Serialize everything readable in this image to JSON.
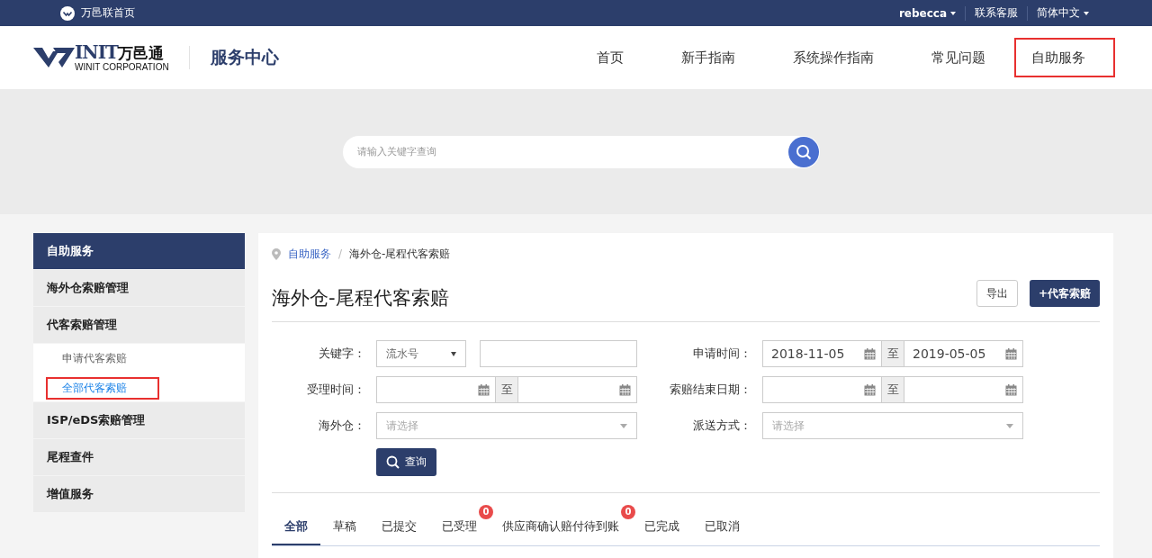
{
  "topbar": {
    "home_link": "万邑联首页",
    "user": "rebecca",
    "support": "联系客服",
    "language": "简体中文"
  },
  "header": {
    "logo_letters": "INIT",
    "logo_name": "万邑通",
    "logo_sub": "WINIT CORPORATION",
    "site_title": "服务中心",
    "nav": [
      {
        "label": "首页",
        "selected": false
      },
      {
        "label": "新手指南",
        "selected": false
      },
      {
        "label": "系统操作指南",
        "selected": false
      },
      {
        "label": "常见问题",
        "selected": false
      },
      {
        "label": "自助服务",
        "selected": true
      }
    ]
  },
  "search": {
    "placeholder": "请输入关键字查询"
  },
  "sidebar": {
    "title": "自助服务",
    "groups": [
      {
        "label": "海外仓索赔管理"
      },
      {
        "label": "代客索赔管理",
        "children": [
          {
            "label": "申请代客索赔",
            "selected": false
          },
          {
            "label": "全部代客索赔",
            "selected": true
          }
        ]
      },
      {
        "label": "ISP/eDS索赔管理"
      },
      {
        "label": "尾程查件"
      },
      {
        "label": "增值服务"
      }
    ]
  },
  "breadcrumb": {
    "separator": "/",
    "items": [
      "自助服务",
      "海外仓-尾程代客索赔"
    ]
  },
  "title": "海外仓-尾程代客索赔",
  "actions": {
    "export": "导出",
    "add": "+代客索赔"
  },
  "filters": [
    {
      "kind": "keyword",
      "label": "关键字：",
      "option": "流水号"
    },
    {
      "kind": "daterange",
      "label": "申请时间：",
      "from": "2018-11-05",
      "to": "2019-05-05",
      "separator": "至"
    },
    {
      "kind": "daterange",
      "label": "受理时间：",
      "separator": "至"
    },
    {
      "kind": "daterange",
      "label": "索赔结束日期：",
      "separator": "至"
    },
    {
      "kind": "select",
      "label": "海外仓：",
      "placeholder": "请选择"
    },
    {
      "kind": "select",
      "label": "派送方式：",
      "placeholder": "请选择"
    }
  ],
  "query_button": "查询",
  "tabs": [
    {
      "label": "全部",
      "selected": true
    },
    {
      "label": "草稿",
      "selected": false
    },
    {
      "label": "已提交",
      "selected": false
    },
    {
      "label": "已受理",
      "selected": false,
      "badge": "0"
    },
    {
      "label": "供应商确认赔付待到账",
      "selected": false,
      "badge": "0"
    },
    {
      "label": "已完成",
      "selected": false
    },
    {
      "label": "已取消",
      "selected": false
    }
  ]
}
